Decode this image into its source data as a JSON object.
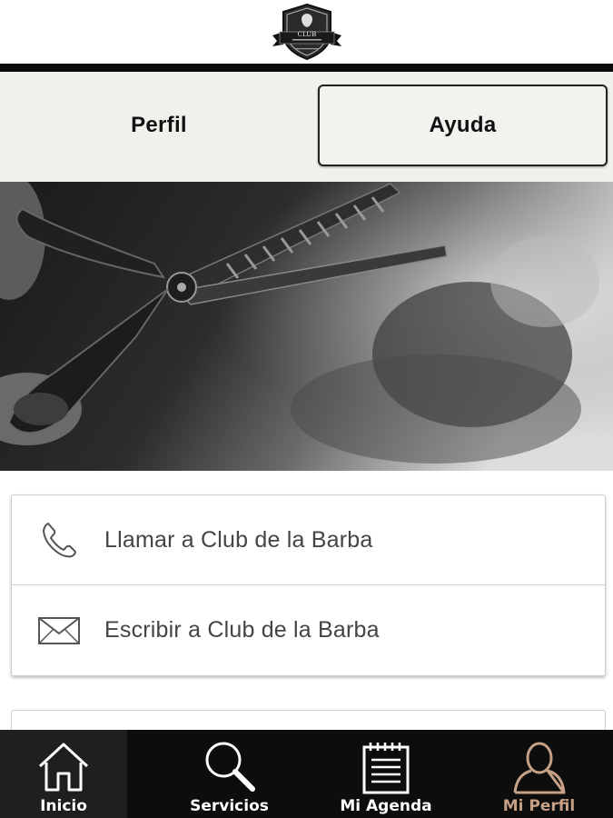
{
  "header": {
    "logo_icon": "club-barber-shield-logo",
    "logo_text": "CLUB"
  },
  "tabs": [
    {
      "label": "Perfil",
      "active": false
    },
    {
      "label": "Ayuda",
      "active": true
    }
  ],
  "banner": {
    "image": "barber-scissors-photo"
  },
  "contact": [
    {
      "icon": "phone-icon",
      "label": "Llamar a Club de la Barba"
    },
    {
      "icon": "envelope-icon",
      "label": "Escribir a Club de la Barba"
    }
  ],
  "bottom_nav": [
    {
      "icon": "home-icon",
      "label": "Inicio"
    },
    {
      "icon": "search-icon",
      "label": "Servicios"
    },
    {
      "icon": "agenda-icon",
      "label": "Mi Agenda"
    },
    {
      "icon": "user-icon",
      "label": "Mi Perfil",
      "active": true
    }
  ],
  "colors": {
    "nav_background": "#0d0d0d",
    "nav_active_accent": "#c7a186",
    "tabs_background": "#f2f0ec"
  }
}
